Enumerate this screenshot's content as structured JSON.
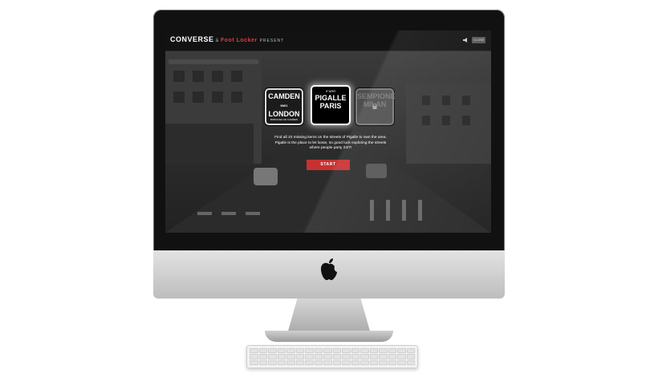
{
  "header": {
    "brand": "CONVERSE",
    "amp": "&",
    "partner": "Foot Locker",
    "present": "PRESENT",
    "close_label": "CLOSE"
  },
  "cities": [
    {
      "top": "",
      "name_line1": "CAMDEN",
      "name_badge": "NW1",
      "name_line2": "LONDON",
      "sub": "BOROUGH OF CAMDEN",
      "state": "available"
    },
    {
      "top": "9°ARR",
      "name_line1": "PIGALLE",
      "name_badge": "",
      "name_line2": "PARIS",
      "sub": "",
      "state": "active"
    },
    {
      "top": "",
      "name_line1": "SEMPIONE",
      "name_badge": "",
      "name_line2": "MILAN",
      "sub": "",
      "state": "locked"
    }
  ],
  "info": {
    "text": "Find all 10 missing items on the streets of Pigalle to own the area. Pigalle is the place to let loose, so good luck exploring the streets where people party 24/7!"
  },
  "start": {
    "label": "START"
  },
  "colors": {
    "accent": "#c83131",
    "partner": "#e23b3b"
  }
}
